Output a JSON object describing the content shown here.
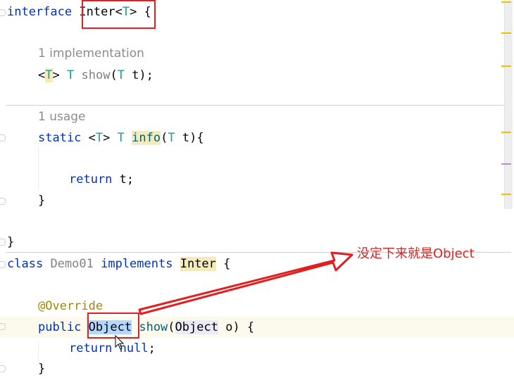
{
  "editor": {
    "hint_implementation": "1 implementation",
    "hint_usage": "1 usage",
    "lines": {
      "interface_kw": "interface",
      "inter_name": "Inter",
      "lt": "<",
      "type_param": "T",
      "gt": ">",
      "open_brace": " {",
      "show_lt": "<",
      "show_T1": "T",
      "show_gt": ">",
      "show_T2": "T",
      "show_name": "show",
      "show_paren_open": "(",
      "show_T3": "T",
      "show_rest": " t);",
      "static_kw": "static",
      "info_lt": " <",
      "info_T1": "T",
      "info_gt": ">",
      "info_T2": "T",
      "info_name": "info",
      "info_paren_open": "(",
      "info_T3": "T",
      "info_rest": " t){",
      "return_kw": "return",
      "return_rest": " t;",
      "close_brace_inner": "}",
      "close_brace_outer": "}",
      "class_kw": "class",
      "demo_name": "Demo01",
      "implements_kw": "implements",
      "inter_ref": "Inter",
      "class_open": " {",
      "override_ann": "@Override",
      "public_kw": "public",
      "object_ret": "Object",
      "show2_name": "show",
      "show2_paren": "(",
      "object_param": "Object",
      "show2_rest": " o) {",
      "return2_kw": "return",
      "null_kw": "null",
      "semicolon": ";",
      "close_brace_last": "}"
    }
  },
  "annotation_text": "没定下来就是Object",
  "colors": {
    "keyword": "#0033b3",
    "type_param": "#20999d",
    "method": "#00627a",
    "annotation": "#9e880d",
    "highlight_red": "#e02020"
  }
}
